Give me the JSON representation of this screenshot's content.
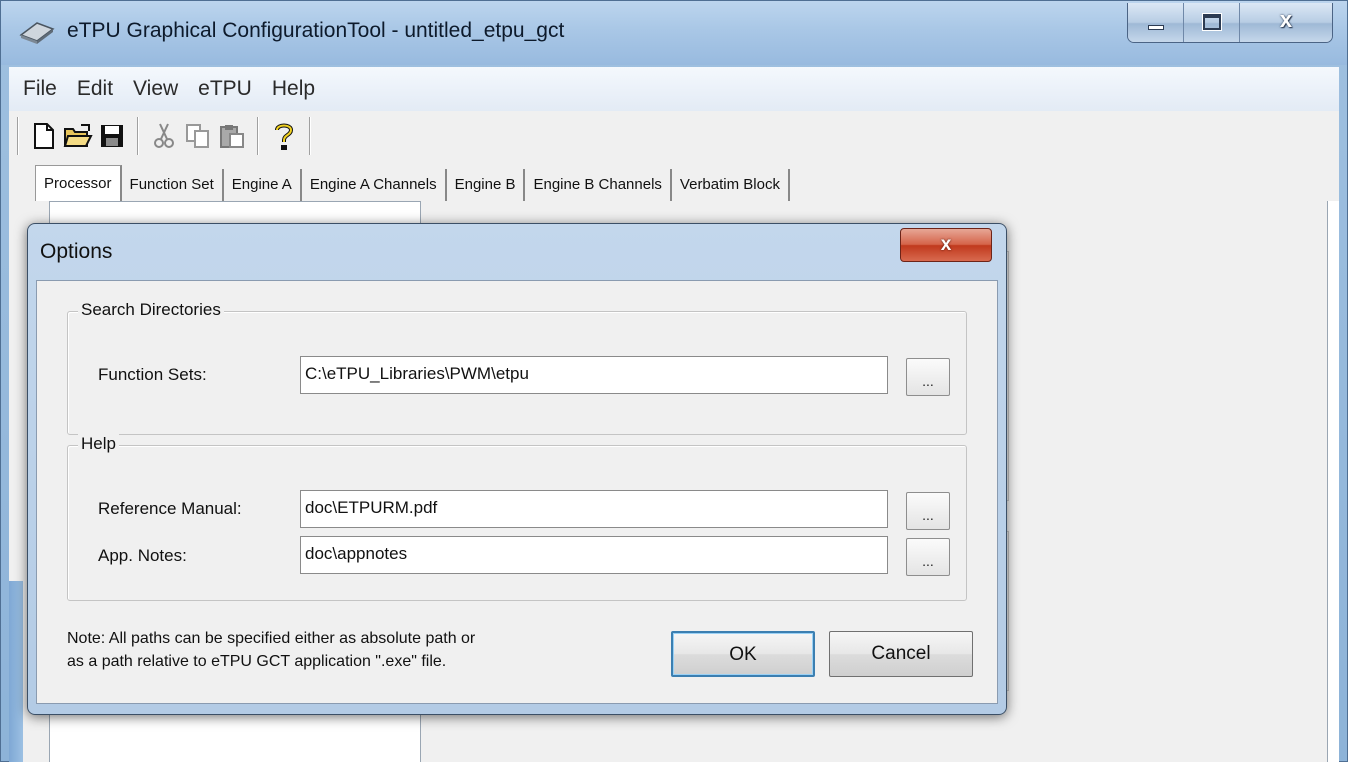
{
  "window": {
    "title": "eTPU Graphical ConfigurationTool - untitled_etpu_gct",
    "close_glyph": "x"
  },
  "menu": [
    "File",
    "Edit",
    "View",
    "eTPU",
    "Help"
  ],
  "toolbar": {
    "icons": [
      "new-file-icon",
      "open-folder-icon",
      "save-icon",
      "cut-icon",
      "copy-icon",
      "paste-icon",
      "help-icon"
    ]
  },
  "tabs": [
    {
      "label": "Processor",
      "active": true
    },
    {
      "label": "Function Set",
      "active": false
    },
    {
      "label": "Engine A",
      "active": false
    },
    {
      "label": "Engine A Channels",
      "active": false
    },
    {
      "label": "Engine B",
      "active": false
    },
    {
      "label": "Engine B Channels",
      "active": false
    },
    {
      "label": "Verbatim Block",
      "active": false
    }
  ],
  "dialog": {
    "title": "Options",
    "close_glyph": "x",
    "search_group": {
      "legend": "Search Directories",
      "function_sets_label": "Function Sets:",
      "function_sets_value": "C:\\eTPU_Libraries\\PWM\\etpu",
      "browse_label": "..."
    },
    "help_group": {
      "legend": "Help",
      "ref_manual_label": "Reference Manual:",
      "ref_manual_value": "doc\\ETPURM.pdf",
      "app_notes_label": "App. Notes:",
      "app_notes_value": "doc\\appnotes",
      "browse_label": "..."
    },
    "note_line1": "Note: All paths can be specified either as absolute path or",
    "note_line2": "as a path relative to eTPU GCT application \".exe\" file.",
    "ok_label": "OK",
    "cancel_label": "Cancel"
  },
  "colors": {
    "title_bar": "#a9c7e6",
    "dialog_close": "#c0391d",
    "default_button_border": "#3c7fb1"
  }
}
